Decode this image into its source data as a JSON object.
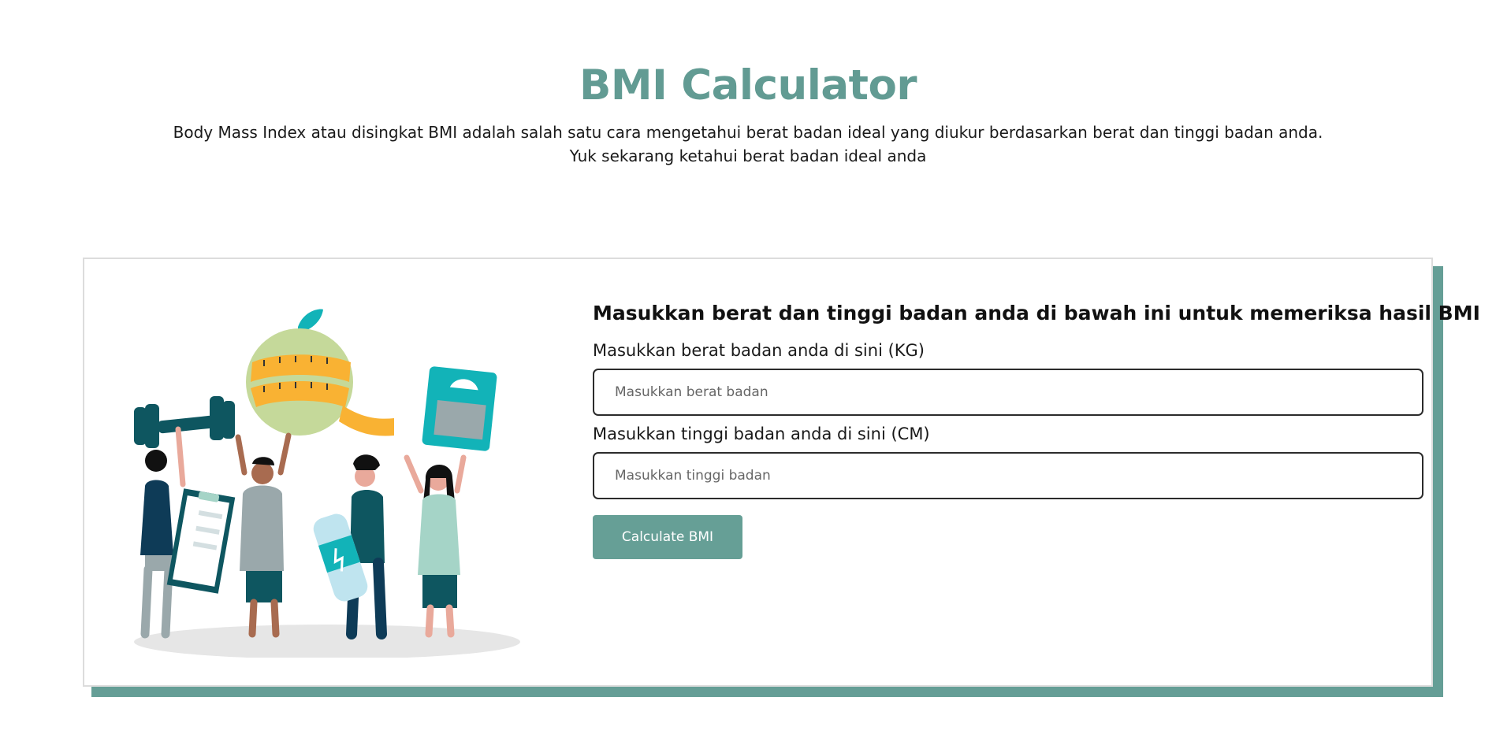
{
  "header": {
    "title": "BMI Calculator",
    "intro_line1": "Body Mass Index atau disingkat BMI adalah salah satu cara mengetahui berat badan ideal yang diukur berdasarkan berat dan tinggi badan anda.",
    "intro_line2": "Yuk sekarang ketahui berat badan ideal anda"
  },
  "form": {
    "heading": "Masukkan berat dan tinggi badan anda di bawah ini untuk memeriksa hasil BMI",
    "weight_label": "Masukkan berat badan anda di sini (KG)",
    "weight_placeholder": "Masukkan berat badan",
    "weight_value": "",
    "height_label": "Masukkan tinggi badan anda di sini (CM)",
    "height_placeholder": "Masukkan tinggi badan",
    "height_value": "",
    "button_label": "Calculate BMI"
  },
  "colors": {
    "accent": "#629b93",
    "button": "#669f96",
    "teal_dark": "#0e5660",
    "teal_bright": "#12b3b8",
    "tape_yellow": "#f9b233",
    "apple_green": "#c5d99a"
  }
}
